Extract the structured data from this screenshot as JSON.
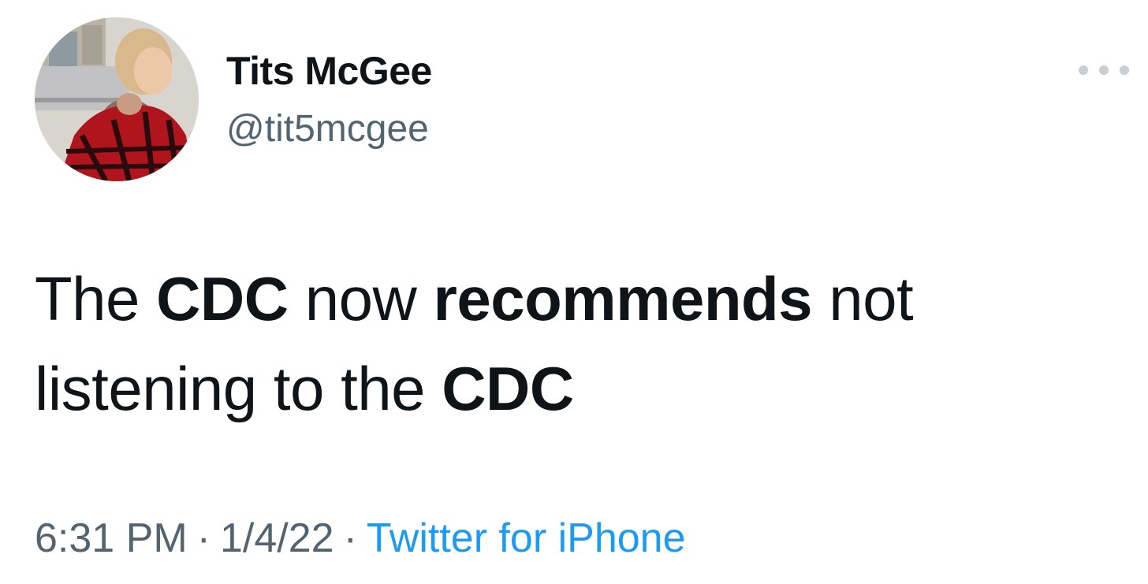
{
  "author": {
    "display_name": "Tits McGee",
    "handle": "@tit5mcgee"
  },
  "tweet": {
    "line1": {
      "w1": "The",
      "w2": "CDC",
      "w3": "now",
      "w4": "recommends",
      "w5": "not"
    },
    "line2": {
      "w1": "listening to the",
      "w2": "CDC"
    }
  },
  "meta": {
    "time": "6:31 PM",
    "separator": "·",
    "date": "1/4/22",
    "source": "Twitter for iPhone"
  },
  "icons": {
    "more": "more-horizontal-icon",
    "avatar": "profile-photo"
  },
  "colors": {
    "text": "#0f1419",
    "secondary": "#536471",
    "link": "#1d9bf0",
    "dots": "#c4cfd6"
  }
}
